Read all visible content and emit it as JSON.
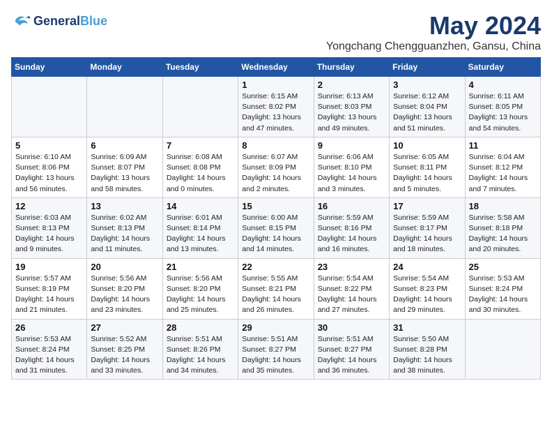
{
  "logo": {
    "line1": "General",
    "line2": "Blue",
    "tagline": ""
  },
  "title": "May 2024",
  "subtitle": "Yongchang Chengguanzhen, Gansu, China",
  "days_of_week": [
    "Sunday",
    "Monday",
    "Tuesday",
    "Wednesday",
    "Thursday",
    "Friday",
    "Saturday"
  ],
  "weeks": [
    [
      {
        "day": "",
        "info": ""
      },
      {
        "day": "",
        "info": ""
      },
      {
        "day": "",
        "info": ""
      },
      {
        "day": "1",
        "info": "Sunrise: 6:15 AM\nSunset: 8:02 PM\nDaylight: 13 hours\nand 47 minutes."
      },
      {
        "day": "2",
        "info": "Sunrise: 6:13 AM\nSunset: 8:03 PM\nDaylight: 13 hours\nand 49 minutes."
      },
      {
        "day": "3",
        "info": "Sunrise: 6:12 AM\nSunset: 8:04 PM\nDaylight: 13 hours\nand 51 minutes."
      },
      {
        "day": "4",
        "info": "Sunrise: 6:11 AM\nSunset: 8:05 PM\nDaylight: 13 hours\nand 54 minutes."
      }
    ],
    [
      {
        "day": "5",
        "info": "Sunrise: 6:10 AM\nSunset: 8:06 PM\nDaylight: 13 hours\nand 56 minutes."
      },
      {
        "day": "6",
        "info": "Sunrise: 6:09 AM\nSunset: 8:07 PM\nDaylight: 13 hours\nand 58 minutes."
      },
      {
        "day": "7",
        "info": "Sunrise: 6:08 AM\nSunset: 8:08 PM\nDaylight: 14 hours\nand 0 minutes."
      },
      {
        "day": "8",
        "info": "Sunrise: 6:07 AM\nSunset: 8:09 PM\nDaylight: 14 hours\nand 2 minutes."
      },
      {
        "day": "9",
        "info": "Sunrise: 6:06 AM\nSunset: 8:10 PM\nDaylight: 14 hours\nand 3 minutes."
      },
      {
        "day": "10",
        "info": "Sunrise: 6:05 AM\nSunset: 8:11 PM\nDaylight: 14 hours\nand 5 minutes."
      },
      {
        "day": "11",
        "info": "Sunrise: 6:04 AM\nSunset: 8:12 PM\nDaylight: 14 hours\nand 7 minutes."
      }
    ],
    [
      {
        "day": "12",
        "info": "Sunrise: 6:03 AM\nSunset: 8:13 PM\nDaylight: 14 hours\nand 9 minutes."
      },
      {
        "day": "13",
        "info": "Sunrise: 6:02 AM\nSunset: 8:13 PM\nDaylight: 14 hours\nand 11 minutes."
      },
      {
        "day": "14",
        "info": "Sunrise: 6:01 AM\nSunset: 8:14 PM\nDaylight: 14 hours\nand 13 minutes."
      },
      {
        "day": "15",
        "info": "Sunrise: 6:00 AM\nSunset: 8:15 PM\nDaylight: 14 hours\nand 14 minutes."
      },
      {
        "day": "16",
        "info": "Sunrise: 5:59 AM\nSunset: 8:16 PM\nDaylight: 14 hours\nand 16 minutes."
      },
      {
        "day": "17",
        "info": "Sunrise: 5:59 AM\nSunset: 8:17 PM\nDaylight: 14 hours\nand 18 minutes."
      },
      {
        "day": "18",
        "info": "Sunrise: 5:58 AM\nSunset: 8:18 PM\nDaylight: 14 hours\nand 20 minutes."
      }
    ],
    [
      {
        "day": "19",
        "info": "Sunrise: 5:57 AM\nSunset: 8:19 PM\nDaylight: 14 hours\nand 21 minutes."
      },
      {
        "day": "20",
        "info": "Sunrise: 5:56 AM\nSunset: 8:20 PM\nDaylight: 14 hours\nand 23 minutes."
      },
      {
        "day": "21",
        "info": "Sunrise: 5:56 AM\nSunset: 8:20 PM\nDaylight: 14 hours\nand 25 minutes."
      },
      {
        "day": "22",
        "info": "Sunrise: 5:55 AM\nSunset: 8:21 PM\nDaylight: 14 hours\nand 26 minutes."
      },
      {
        "day": "23",
        "info": "Sunrise: 5:54 AM\nSunset: 8:22 PM\nDaylight: 14 hours\nand 27 minutes."
      },
      {
        "day": "24",
        "info": "Sunrise: 5:54 AM\nSunset: 8:23 PM\nDaylight: 14 hours\nand 29 minutes."
      },
      {
        "day": "25",
        "info": "Sunrise: 5:53 AM\nSunset: 8:24 PM\nDaylight: 14 hours\nand 30 minutes."
      }
    ],
    [
      {
        "day": "26",
        "info": "Sunrise: 5:53 AM\nSunset: 8:24 PM\nDaylight: 14 hours\nand 31 minutes."
      },
      {
        "day": "27",
        "info": "Sunrise: 5:52 AM\nSunset: 8:25 PM\nDaylight: 14 hours\nand 33 minutes."
      },
      {
        "day": "28",
        "info": "Sunrise: 5:51 AM\nSunset: 8:26 PM\nDaylight: 14 hours\nand 34 minutes."
      },
      {
        "day": "29",
        "info": "Sunrise: 5:51 AM\nSunset: 8:27 PM\nDaylight: 14 hours\nand 35 minutes."
      },
      {
        "day": "30",
        "info": "Sunrise: 5:51 AM\nSunset: 8:27 PM\nDaylight: 14 hours\nand 36 minutes."
      },
      {
        "day": "31",
        "info": "Sunrise: 5:50 AM\nSunset: 8:28 PM\nDaylight: 14 hours\nand 38 minutes."
      },
      {
        "day": "",
        "info": ""
      }
    ]
  ]
}
